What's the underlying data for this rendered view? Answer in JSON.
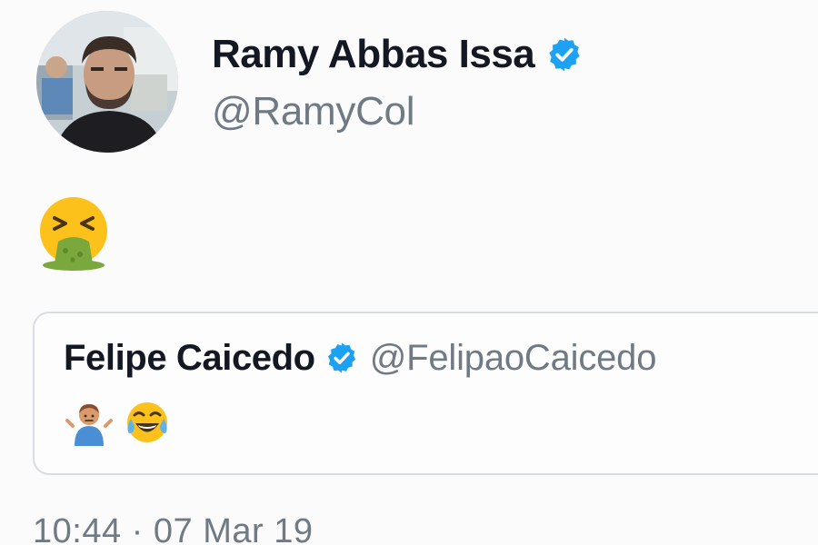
{
  "tweet": {
    "author": {
      "display_name": "Ramy Abbas Issa",
      "handle": "@RamyCol",
      "verified": true,
      "avatar_icon": "profile-photo"
    },
    "body_emoji": "face-vomiting-emoji",
    "quoted_tweet": {
      "display_name": "Felipe Caicedo",
      "handle": "@FelipaoCaicedo",
      "verified": true,
      "emojis": [
        "person-shrugging-emoji",
        "face-with-tears-of-joy-emoji"
      ]
    },
    "timestamp": "10:44 · 07 Mar 19"
  },
  "colors": {
    "name": "#141823",
    "secondary_text": "#6f7a85",
    "verified_blue": "#1da1f2",
    "border": "#d7dde2"
  }
}
